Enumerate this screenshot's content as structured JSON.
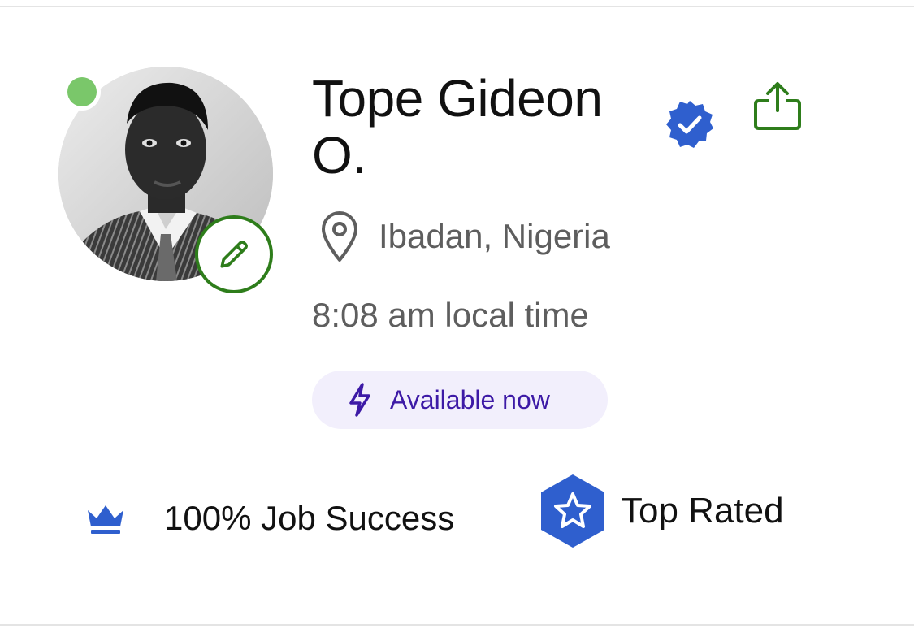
{
  "profile": {
    "name": "Tope Gideon O.",
    "location": "Ibadan, Nigeria",
    "local_time": "8:08 am local time",
    "availability": "Available now",
    "online": true,
    "verified": true
  },
  "stats": {
    "job_success": "100% Job Success",
    "badge": "Top Rated"
  },
  "icons": {
    "online": "online-status-dot",
    "edit": "pencil-icon",
    "verified": "verified-badge-icon",
    "share": "share-icon",
    "location": "map-pin-icon",
    "availability": "lightning-bolt-icon",
    "job_success": "crown-icon",
    "top_rated": "star-hexagon-icon"
  },
  "colors": {
    "online": "#7ac76a",
    "edit_ring": "#2e7d1b",
    "verified": "#2f5fce",
    "share": "#2e7d1b",
    "availability_bg": "#f2effc",
    "availability_text": "#3d1aa6",
    "top_rated": "#2f5fce",
    "crown": "#2f5fce",
    "secondary_text": "#5e5e5e"
  }
}
